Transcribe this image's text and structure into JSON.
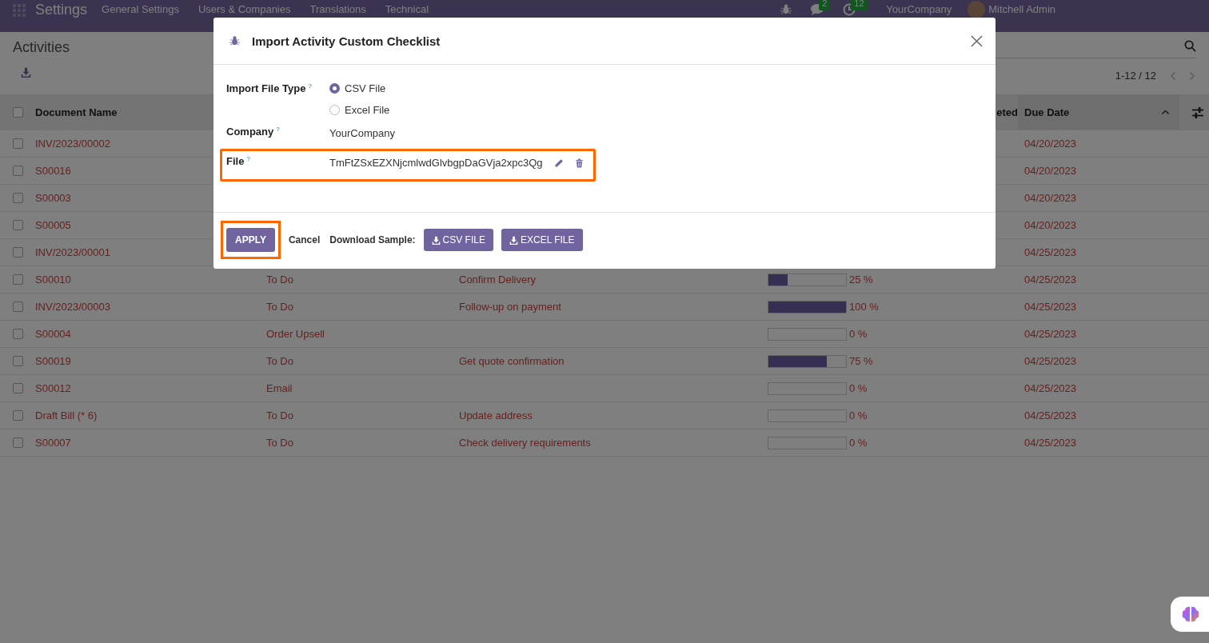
{
  "navbar": {
    "app": "Settings",
    "menus": [
      "General Settings",
      "Users & Companies",
      "Translations",
      "Technical"
    ],
    "messages_badge": "2",
    "activities_badge": "12",
    "company": "YourCompany",
    "user": "Mitchell Admin"
  },
  "control_panel": {
    "title": "Activities",
    "pager": "1-12 / 12"
  },
  "table": {
    "select_all_checked": false,
    "columns": [
      {
        "label": "Document Name"
      },
      {},
      {},
      {
        "label": "eted"
      },
      {
        "label": "Due Date"
      }
    ],
    "rows": [
      {
        "checked": false,
        "name": "INV/2023/00002",
        "due": "04/20/2023"
      },
      {
        "checked": false,
        "name": "S00016",
        "due": "04/20/2023"
      },
      {
        "checked": false,
        "name": "S00003",
        "due": "04/20/2023"
      },
      {
        "checked": false,
        "name": "S00005",
        "due": "04/20/2023"
      },
      {
        "checked": false,
        "name": "INV/2023/00001",
        "due": "04/25/2023"
      },
      {
        "checked": false,
        "name": "S00010",
        "type": "To Do",
        "summary": "Confirm Delivery",
        "level": 0.25,
        "reading": "25 %",
        "due": "04/25/2023"
      },
      {
        "checked": false,
        "name": "INV/2023/00003",
        "type": "To Do",
        "summary": "Follow-up on payment",
        "level": 1,
        "reading": "100 %",
        "due": "04/25/2023"
      },
      {
        "checked": false,
        "name": "S00004",
        "type": "Order Upsell",
        "level": 0,
        "reading": "0 %",
        "due": "04/25/2023"
      },
      {
        "checked": false,
        "name": "S00019",
        "type": "To Do",
        "summary": "Get quote confirmation",
        "level": 0.75,
        "reading": "75 %",
        "due": "04/25/2023"
      },
      {
        "checked": false,
        "name": "S00012",
        "type": "Email",
        "level": 0,
        "reading": "0 %",
        "due": "04/25/2023"
      },
      {
        "checked": false,
        "name": "Draft Bill (* 6)",
        "type": "To Do",
        "summary": "Update address",
        "level": 0,
        "reading": "0 %",
        "due": "04/25/2023"
      },
      {
        "checked": false,
        "name": "S00007",
        "type": "To Do",
        "summary": "Check delivery requirements",
        "level": 0,
        "reading": "0 %",
        "due": "04/25/2023"
      }
    ]
  },
  "dialog": {
    "title": "Import Activity Custom Checklist",
    "fields": [
      {
        "kind": "radio",
        "label": "Import File Type",
        "help": "?",
        "options": [
          {
            "label": "CSV File",
            "selected": true
          },
          {
            "label": "Excel File",
            "selected": false
          }
        ]
      },
      {
        "kind": "text",
        "label": "Company",
        "help": "?",
        "value": "YourCompany"
      },
      {
        "kind": "file",
        "label": "File",
        "help": "?",
        "value": "TmFtZSxEZXNjcmlwdGlvbgpDaGVja2xpc3Qg",
        "highlighted": true
      }
    ],
    "apply": {
      "label": "APPLY",
      "highlighted": true
    },
    "cancel": "Cancel",
    "download_label": "Download Sample:",
    "sample_buttons": [
      "CSV FILE",
      "EXCEL FILE"
    ]
  }
}
